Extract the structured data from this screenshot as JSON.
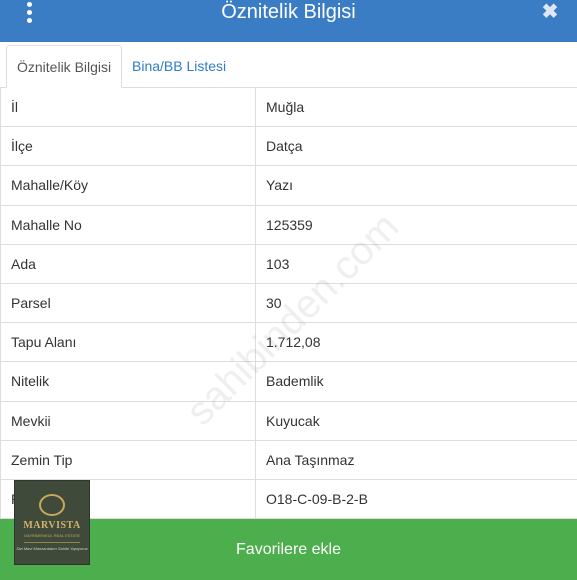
{
  "header": {
    "title": "Öznitelik Bilgisi",
    "close_symbol": "✖"
  },
  "tabs": [
    {
      "label": "Öznitelik Bilgisi",
      "active": true
    },
    {
      "label": "Bina/BB Listesi",
      "active": false
    }
  ],
  "attributes": [
    {
      "label": "İl",
      "value": "Muğla"
    },
    {
      "label": "İlçe",
      "value": "Datça"
    },
    {
      "label": "Mahalle/Köy",
      "value": "Yazı"
    },
    {
      "label": "Mahalle No",
      "value": "125359"
    },
    {
      "label": "Ada",
      "value": "103"
    },
    {
      "label": "Parsel",
      "value": "30"
    },
    {
      "label": "Tapu Alanı",
      "value": "1.712,08"
    },
    {
      "label": "Nitelik",
      "value": "Bademlik"
    },
    {
      "label": "Mevkii",
      "value": "Kuyucak"
    },
    {
      "label": "Zemin Tip",
      "value": "Ana Taşınmaz"
    },
    {
      "label": "Pafta",
      "value": "O18-C-09-B-2-B"
    }
  ],
  "watermark": "sahibinden.com",
  "favorites_button": {
    "label": "Favorilere ekle"
  },
  "logo": {
    "name": "MARVISTA",
    "subtitle": "GAYRİMENKUL REAL ESTATE",
    "tagline": "Sizi Mavi Manzaraların Sahibi Yapıyoruz"
  },
  "colors": {
    "header_bg": "#3a7dc4",
    "tab_link": "#2f7dc8",
    "button_bg": "#4cae4c"
  }
}
